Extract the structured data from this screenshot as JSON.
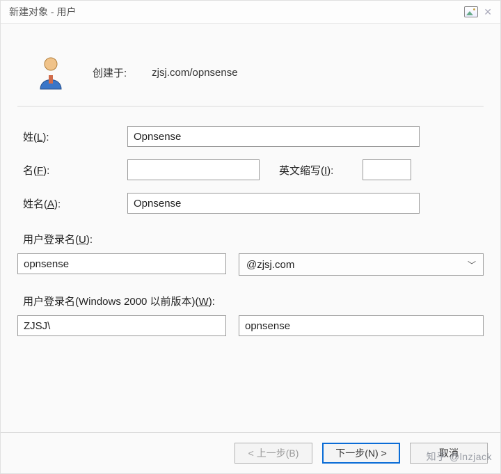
{
  "title": "新建对象 - 用户",
  "header": {
    "created_in_label": "创建于:",
    "path": "zjsj.com/opnsense"
  },
  "fields": {
    "surname": {
      "label_pre": "姓(",
      "hot": "L",
      "label_post": "):",
      "value": "Opnsense"
    },
    "given": {
      "label_pre": "名(",
      "hot": "F",
      "label_post": "):",
      "value": ""
    },
    "initials": {
      "label_pre": "英文缩写(",
      "hot": "I",
      "label_post": "):",
      "value": ""
    },
    "fullname": {
      "label_pre": "姓名(",
      "hot": "A",
      "label_post": "):",
      "value": "Opnsense"
    }
  },
  "logon": {
    "label_pre": "用户登录名(",
    "hot": "U",
    "label_post": "):",
    "value": "opnsense",
    "domain_selected": "@zjsj.com"
  },
  "logon_nt": {
    "label_pre": "用户登录名(Windows 2000 以前版本)(",
    "hot": "W",
    "label_post": "):",
    "domain": "ZJSJ\\",
    "user": "opnsense"
  },
  "buttons": {
    "back": "< 上一步(B)",
    "next": "下一步(N)  >",
    "cancel": "取消"
  },
  "watermark": "知乎  @lnzjack"
}
